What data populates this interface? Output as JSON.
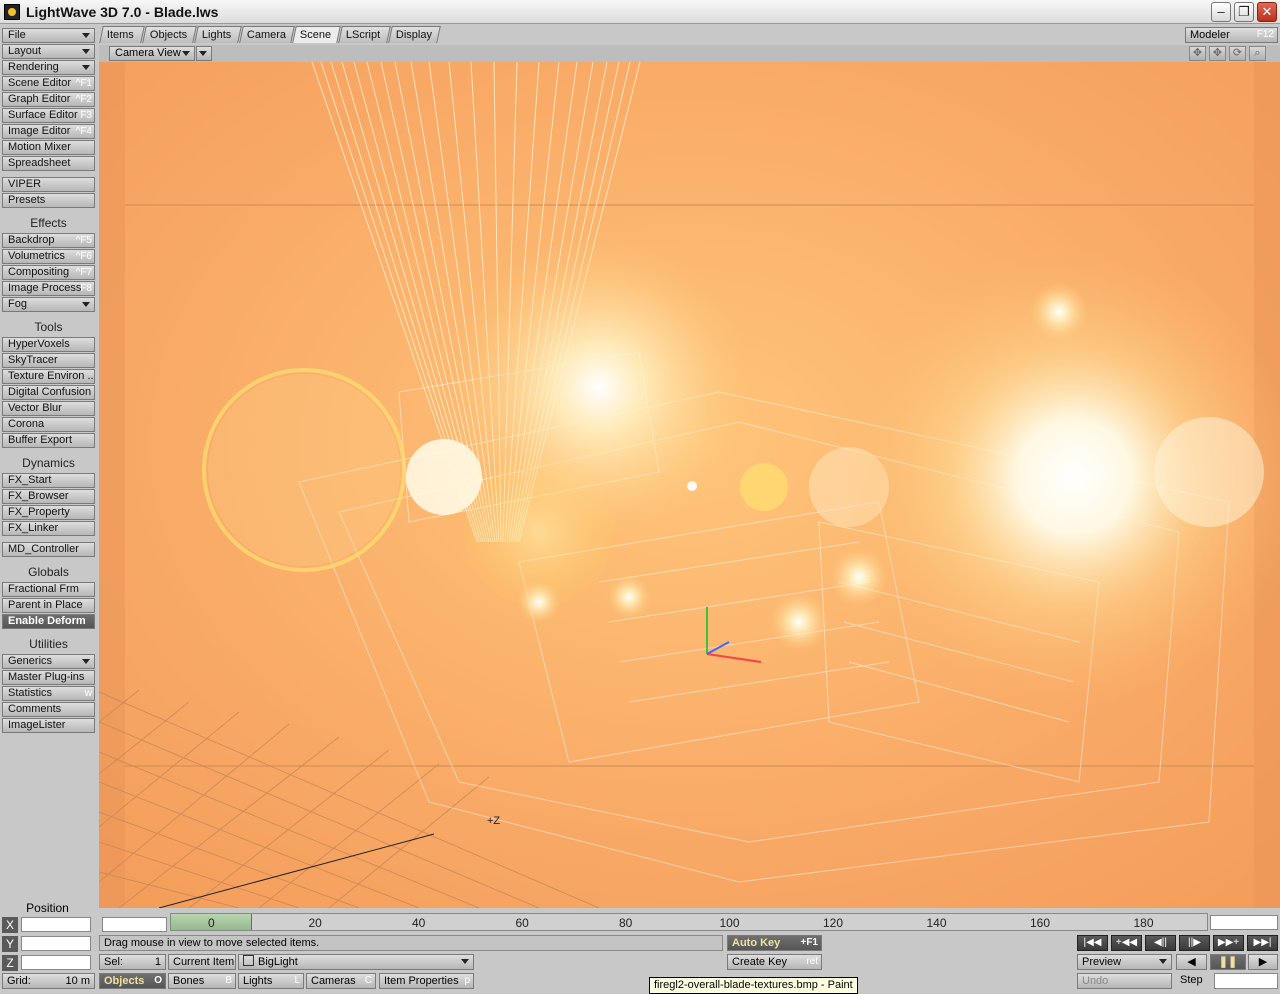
{
  "window": {
    "title": "LightWave 3D 7.0 - Blade.lws"
  },
  "sidebar": [
    {
      "label": "File",
      "dropdown": true
    },
    {
      "label": "Layout",
      "dropdown": true
    },
    {
      "label": "Rendering",
      "dropdown": true
    },
    {
      "label": "Scene Editor",
      "shortcut": "^F1"
    },
    {
      "label": "Graph Editor",
      "shortcut": "^F2"
    },
    {
      "label": "Surface Editor",
      "shortcut": "F3"
    },
    {
      "label": "Image Editor",
      "shortcut": "^F4"
    },
    {
      "label": "Motion Mixer"
    },
    {
      "label": "Spreadsheet"
    },
    {
      "label": "VIPER"
    },
    {
      "label": "Presets"
    },
    {
      "heading": "Effects"
    },
    {
      "label": "Backdrop",
      "shortcut": "^F5"
    },
    {
      "label": "Volumetrics",
      "shortcut": "^F6"
    },
    {
      "label": "Compositing",
      "shortcut": "^F7"
    },
    {
      "label": "Image Process",
      "shortcut": "F8"
    },
    {
      "label": "Fog",
      "dropdown": true
    },
    {
      "heading": "Tools"
    },
    {
      "label": "HyperVoxels"
    },
    {
      "label": "SkyTracer"
    },
    {
      "label": "Texture Environ ..."
    },
    {
      "label": "Digital Confusion"
    },
    {
      "label": "Vector Blur"
    },
    {
      "label": "Corona"
    },
    {
      "label": "Buffer Export"
    },
    {
      "heading": "Dynamics"
    },
    {
      "label": "FX_Start"
    },
    {
      "label": "FX_Browser"
    },
    {
      "label": "FX_Property"
    },
    {
      "label": "FX_Linker"
    },
    {
      "label": "MD_Controller"
    },
    {
      "heading": "Globals"
    },
    {
      "label": "Fractional Frm"
    },
    {
      "label": "Parent in Place"
    },
    {
      "label": "Enable Deform",
      "active": true
    },
    {
      "heading": "Utilities"
    },
    {
      "label": "Generics",
      "dropdown": true
    },
    {
      "label": "Master Plug-ins"
    },
    {
      "label": "Statistics",
      "shortcut": "w"
    },
    {
      "label": "Comments"
    },
    {
      "label": "ImageLister"
    }
  ],
  "tabs": [
    "Items",
    "Objects",
    "Lights",
    "Camera",
    "Scene",
    "LScript",
    "Display"
  ],
  "active_tab": "Scene",
  "modeler": {
    "label": "Modeler",
    "shortcut": "F12"
  },
  "viewport": {
    "view_mode": "Camera View",
    "axis_label": "+Z"
  },
  "timeline": {
    "ticks": [
      "0",
      "20",
      "40",
      "60",
      "80",
      "100",
      "120",
      "140",
      "160",
      "180"
    ]
  },
  "coords": {
    "heading": "Position",
    "axes": [
      "X",
      "Y",
      "Z"
    ]
  },
  "status": {
    "message": "Drag mouse in view to move selected items."
  },
  "bottom": {
    "grid_label": "Grid:",
    "grid_value": "10 m",
    "sel_label": "Sel:",
    "sel_value": "1",
    "current_item_label": "Current Item",
    "current_item_value": "BigLight",
    "modes": [
      {
        "label": "Objects",
        "shortcut": "O"
      },
      {
        "label": "Bones",
        "shortcut": "B"
      },
      {
        "label": "Lights",
        "shortcut": "L"
      },
      {
        "label": "Cameras",
        "shortcut": "C"
      }
    ],
    "item_properties": {
      "label": "Item Properties",
      "shortcut": "p"
    },
    "auto_key": {
      "label": "Auto Key",
      "shortcut": "+F1"
    },
    "create_key": {
      "label": "Create Key",
      "shortcut": "ret"
    },
    "preview": "Preview",
    "undo": "Undo",
    "step": "Step"
  },
  "tooltip": "firegl2-overall-blade-textures.bmp - Paint",
  "transport": [
    "|◀◀",
    "+◀◀",
    "◀||",
    "||▶",
    "▶▶+",
    "▶▶|"
  ]
}
